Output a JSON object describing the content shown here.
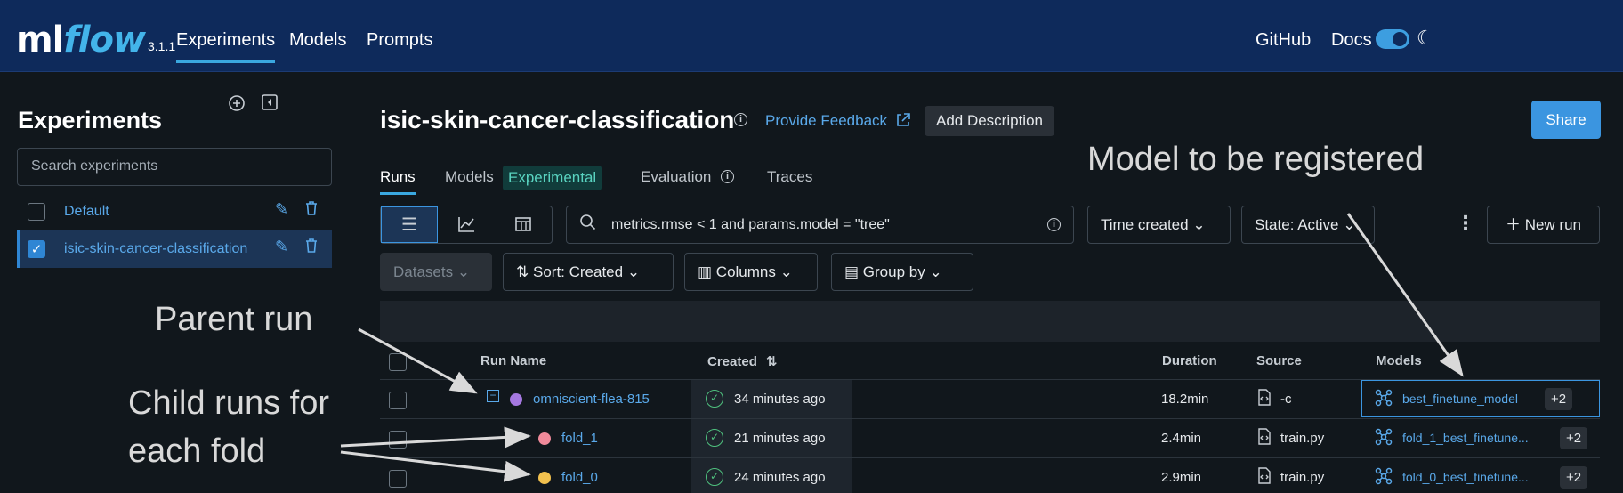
{
  "nav": {
    "logo_ml": "ml",
    "logo_flow": "flow",
    "version": "3.1.1",
    "links": [
      "Experiments",
      "Models",
      "Prompts"
    ],
    "right_links": [
      "GitHub",
      "Docs"
    ]
  },
  "sidebar": {
    "title": "Experiments",
    "search_placeholder": "Search experiments",
    "items": [
      {
        "label": "Default",
        "checked": false
      },
      {
        "label": "isic-skin-cancer-classification",
        "checked": true
      }
    ]
  },
  "header": {
    "title": "isic-skin-cancer-classification",
    "feedback": "Provide Feedback",
    "add_description": "Add Description",
    "share": "Share"
  },
  "tabs": {
    "runs": "Runs",
    "models": "Models",
    "experimental": "Experimental",
    "evaluation": "Evaluation",
    "traces": "Traces"
  },
  "toolbar": {
    "search_value": "metrics.rmse < 1 and params.model = \"tree\"",
    "time_created": "Time created",
    "state": "State: Active",
    "new_run": "New run",
    "datasets": "Datasets",
    "sort": "Sort: Created",
    "columns": "Columns",
    "group_by": "Group by"
  },
  "table": {
    "headers": {
      "run_name": "Run Name",
      "created": "Created",
      "duration": "Duration",
      "source": "Source",
      "models": "Models"
    },
    "rows": [
      {
        "name": "omniscient-flea-815",
        "created": "34 minutes ago",
        "duration": "18.2min",
        "source": "-c",
        "model": "best_finetune_model",
        "extra": "+2",
        "dot": "#a578e0"
      },
      {
        "name": "fold_1",
        "created": "21 minutes ago",
        "duration": "2.4min",
        "source": "train.py",
        "model": "fold_1_best_finetune...",
        "extra": "+2",
        "dot": "#f08a9a"
      },
      {
        "name": "fold_0",
        "created": "24 minutes ago",
        "duration": "2.9min",
        "source": "train.py",
        "model": "fold_0_best_finetune...",
        "extra": "+2",
        "dot": "#f2c14e"
      }
    ]
  },
  "annotations": {
    "model": "Model to be registered",
    "parent": "Parent run",
    "child_line1": "Child runs for",
    "child_line2": "each fold"
  },
  "colors": {
    "nav_bg": "#0e2a5b",
    "page_bg": "#11171c",
    "accent": "#3b95e0",
    "link": "#5aa9ea"
  },
  "icons": [
    "search-icon",
    "info-icon",
    "external-link-icon",
    "pencil-icon",
    "trash-icon",
    "list-view-icon",
    "chart-view-icon",
    "table-view-icon",
    "chevron-down-icon",
    "sort-icon",
    "columns-icon",
    "group-icon",
    "check-circle-icon",
    "model-icon",
    "code-icon",
    "moon-icon",
    "plus-icon",
    "kebab-icon"
  ]
}
